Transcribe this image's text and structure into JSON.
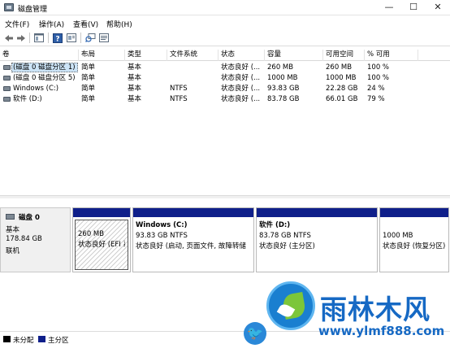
{
  "window": {
    "title": "磁盘管理",
    "minimize": "—",
    "maximize": "☐",
    "close": "✕"
  },
  "menu": [
    "文件(F)",
    "操作(A)",
    "查看(V)",
    "帮助(H)"
  ],
  "volume_table": {
    "columns": [
      "卷",
      "布局",
      "类型",
      "文件系统",
      "状态",
      "容量",
      "可用空间",
      "% 可用"
    ],
    "rows": [
      {
        "volume": "(磁盘 0 磁盘分区 1)",
        "layout": "简单",
        "type": "基本",
        "fs": "",
        "status": "状态良好 (...",
        "capacity": "260 MB",
        "free": "260 MB",
        "pct": "100 %"
      },
      {
        "volume": "(磁盘 0 磁盘分区 5)",
        "layout": "简单",
        "type": "基本",
        "fs": "",
        "status": "状态良好 (...",
        "capacity": "1000 MB",
        "free": "1000 MB",
        "pct": "100 %"
      },
      {
        "volume": "Windows (C:)",
        "layout": "简单",
        "type": "基本",
        "fs": "NTFS",
        "status": "状态良好 (...",
        "capacity": "93.83 GB",
        "free": "22.28 GB",
        "pct": "24 %"
      },
      {
        "volume": "软件 (D:)",
        "layout": "简单",
        "type": "基本",
        "fs": "NTFS",
        "status": "状态良好 (...",
        "capacity": "83.78 GB",
        "free": "66.01 GB",
        "pct": "79 %"
      }
    ]
  },
  "disk0": {
    "name": "磁盘 0",
    "type": "基本",
    "size": "178.84 GB",
    "state": "联机",
    "partitions": [
      {
        "name": "",
        "size": "260 MB",
        "status": "状态良好 (EFI 系"
      },
      {
        "name": "Windows  (C:)",
        "size": "93.83 GB NTFS",
        "status": "状态良好 (启动, 页面文件, 故障转储"
      },
      {
        "name": "软件  (D:)",
        "size": "83.78 GB NTFS",
        "status": "状态良好 (主分区)"
      },
      {
        "name": "",
        "size": "1000 MB",
        "status": "状态良好 (恢复分区)"
      }
    ]
  },
  "legend": {
    "unallocated": "未分配",
    "primary": "主分区",
    "unallocated_color": "#000000",
    "primary_color": "#0f1f8a"
  },
  "watermark": {
    "brand": "雨林木风",
    "url": "www.ylmf888.com"
  }
}
